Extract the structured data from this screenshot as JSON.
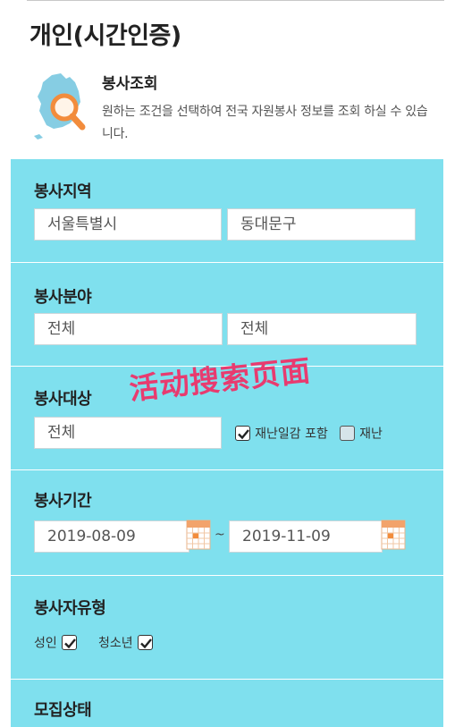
{
  "page": {
    "title": "개인(시간인증)"
  },
  "intro": {
    "icon": "korea-map-search-icon",
    "title": "봉사조회",
    "description": "원하는 조건을 선택하여 전국 자원봉사 정보를 조회 하실 수 있습니다."
  },
  "region": {
    "label": "봉사지역",
    "city": "서울특별시",
    "district": "동대문구"
  },
  "field": {
    "label": "봉사분야",
    "category1": "전체",
    "category2": "전체"
  },
  "target": {
    "label": "봉사대상",
    "value": "전체",
    "options": [
      {
        "label": "재난일감 포함",
        "checked": true
      },
      {
        "label": "재난",
        "checked": false
      }
    ]
  },
  "period": {
    "label": "봉사기간",
    "start": "2019-08-09",
    "separator": "~",
    "end": "2019-11-09",
    "icon": "calendar-icon"
  },
  "type": {
    "label": "봉사자유형",
    "options": [
      {
        "label": "성인",
        "checked": true
      },
      {
        "label": "청소년",
        "checked": true
      }
    ]
  },
  "recruit": {
    "label": "모집상태"
  },
  "watermark": "活动搜索页面",
  "colors": {
    "section_bg": "#7fe0ee",
    "accent": "#f28c3c",
    "watermark": "#e83b6f"
  }
}
